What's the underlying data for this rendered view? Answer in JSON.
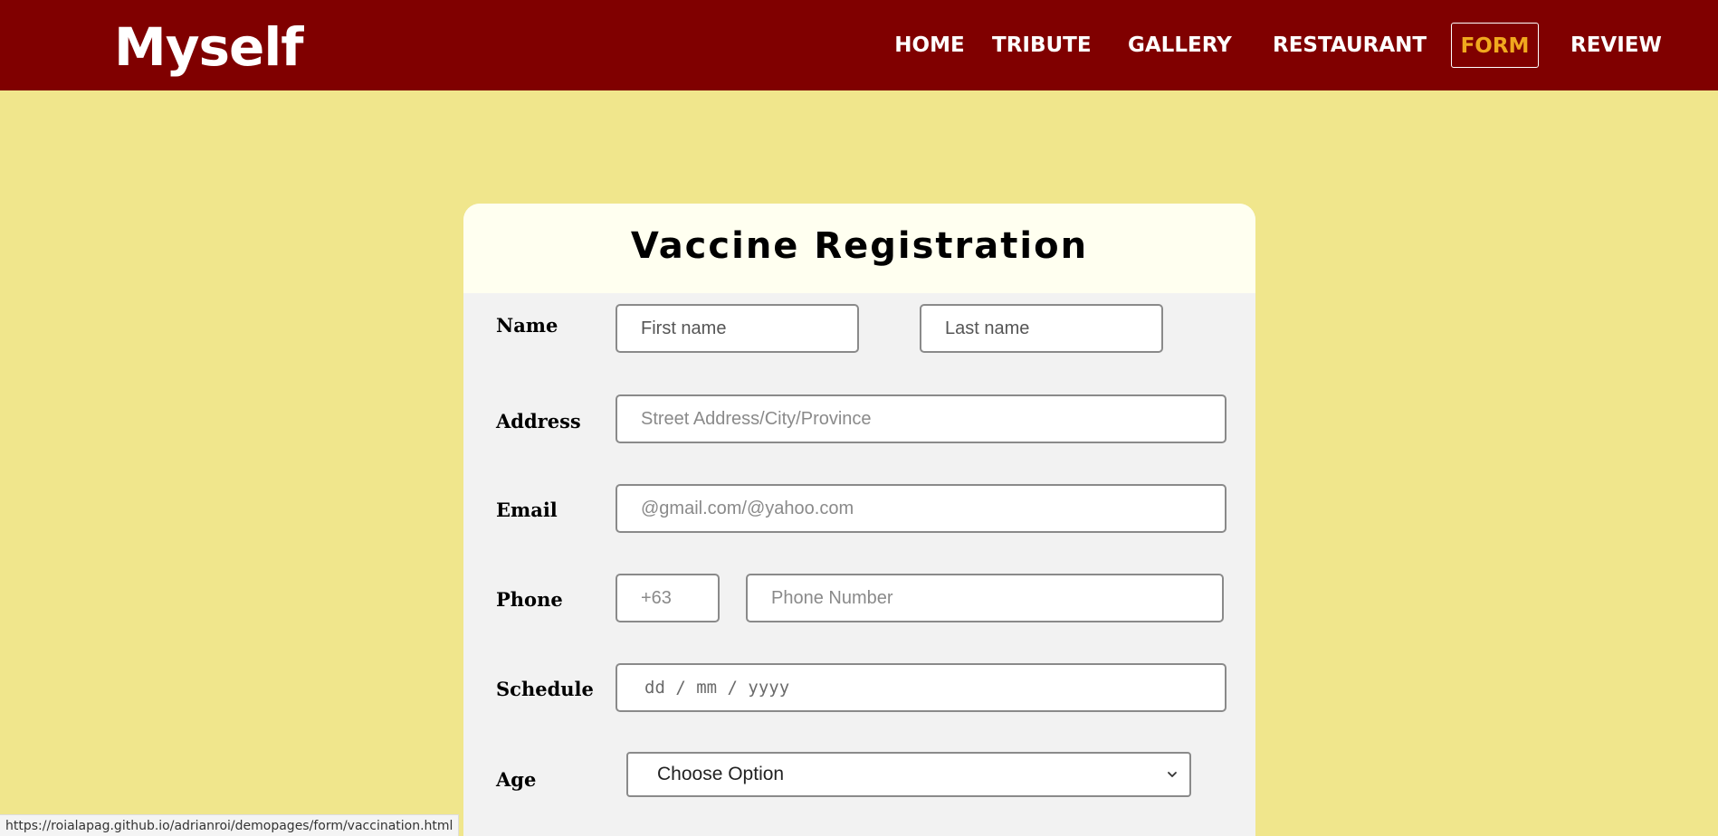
{
  "header": {
    "logo": "Myself",
    "nav": [
      {
        "label": "HOME",
        "active": false
      },
      {
        "label": "TRIBUTE",
        "active": false
      },
      {
        "label": "GALLERY",
        "active": false
      },
      {
        "label": "RESTAURANT",
        "active": false
      },
      {
        "label": "FORM",
        "active": true
      },
      {
        "label": "REVIEW",
        "active": false
      }
    ]
  },
  "form": {
    "title": "Vaccine Registration",
    "name_label": "Name",
    "first_name_placeholder": "First name",
    "last_name_placeholder": "Last name",
    "address_label": "Address",
    "address_placeholder": "Street Address/City/Province",
    "email_label": "Email",
    "email_placeholder": "@gmail.com/@yahoo.com",
    "phone_label": "Phone",
    "phone_code_placeholder": "+63",
    "phone_number_placeholder": "Phone Number",
    "schedule_label": "Schedule",
    "schedule_placeholder": "dd / mm / yyyy",
    "age_label": "Age",
    "age_selected": "Choose Option"
  },
  "status_bar": {
    "url": "https://roialapag.github.io/adrianroi/demopages/form/vaccination.html"
  },
  "colors": {
    "header_bg": "#800000",
    "page_bg": "#f0e68c",
    "active_nav": "#f0a81e"
  }
}
